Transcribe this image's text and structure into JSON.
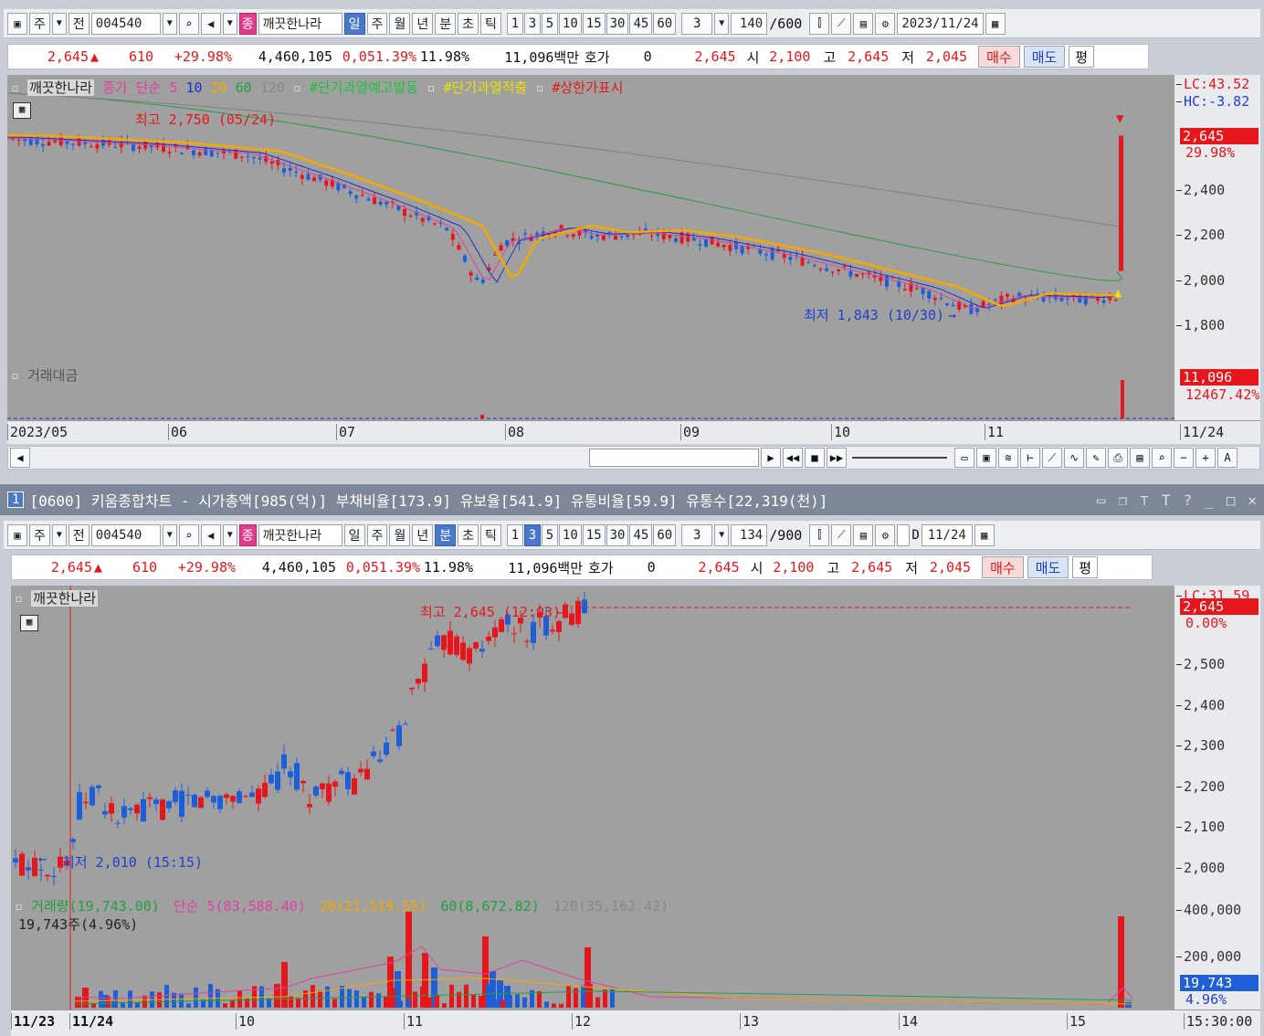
{
  "top": {
    "toolbar": {
      "period": "주",
      "prev": "전",
      "code": "004540",
      "tag": "종",
      "name": "깨끗한나라",
      "tabs": [
        "일",
        "주",
        "월",
        "년",
        "분",
        "초",
        "틱"
      ],
      "active_tab": "일",
      "nums": [
        "1",
        "3",
        "5",
        "10",
        "15",
        "30",
        "45",
        "60"
      ],
      "unit": "3",
      "count": "140",
      "count_max": "/600",
      "date": "2023/11/24"
    },
    "quote": {
      "price": "2,645",
      "change": "610",
      "pct": "+29.98%",
      "volume": "4,460,105",
      "vol2": "0,051.39%",
      "turn": "11.98%",
      "amount": "11,096백만",
      "hoga_label": "호가",
      "hoga": "0",
      "cur": "2,645",
      "open_l": "시",
      "open": "2,100",
      "high_l": "고",
      "high": "2,645",
      "low_l": "저",
      "low": "2,045",
      "buy": "매수",
      "sell": "매도",
      "avg": "평"
    },
    "legend": {
      "name": "깨끗한나라",
      "ma_label": "종가 단순 5",
      "ma10": "10",
      "ma20": "20",
      "ma60": "60",
      "ma120": "120",
      "ind1": "#단기과열예고발동",
      "ind2": "#단기과열적출",
      "ind3": "#상한가표시"
    },
    "annot_high": "최고 2,750 (05/24)",
    "annot_low": "최저 1,843 (10/30)",
    "lc": "LC:43.52",
    "hc": "HC:-3.82",
    "price_tag": "2,645",
    "pct_tag": "29.98%",
    "yticks": [
      "2,400",
      "2,200",
      "2,000",
      "1,800"
    ],
    "vol_label": "거래대금",
    "vol_tag": "11,096",
    "vol_tag2": "12467.42%",
    "xlabels": [
      "2023/05",
      "06",
      "07",
      "08",
      "09",
      "10",
      "11"
    ],
    "x_end": "11/24"
  },
  "window": {
    "num": "1",
    "title": "[0600] 키움종합차트 - 시가총액[985(억)] 부채비율[173.9] 유보율[541.9] 유통비율[59.9] 유통수[22,319(천)]"
  },
  "bottom": {
    "toolbar": {
      "period": "주",
      "prev": "전",
      "code": "004540",
      "tag": "종",
      "name": "깨끗한나라",
      "tabs": [
        "일",
        "주",
        "월",
        "년",
        "분",
        "초",
        "틱"
      ],
      "active_tab": "분",
      "nums": [
        "1",
        "3",
        "5",
        "10",
        "15",
        "30",
        "45",
        "60"
      ],
      "active_num": "3",
      "unit": "3",
      "count": "134",
      "count_max": "/900",
      "dchk": "D",
      "date": "11/24"
    },
    "legend_name": "깨끗한나라",
    "annot_high": "최고 2,645 (12:03)",
    "annot_low": "최저 2,010 (15:15)",
    "lc": "LC:31.59",
    "price_tag": "2,645",
    "pct_tag": "0.00%",
    "yticks": [
      "2,500",
      "2,400",
      "2,300",
      "2,200",
      "2,100",
      "2,000"
    ],
    "vol_legend": {
      "main": "거래량(19,743.00)",
      "ma5": "단순 5(83,588.40)",
      "ma20": "20(21,519.55)",
      "ma60": "60(8,672.82)",
      "ma120": "120(35,162.42)"
    },
    "vol_sub": "19,743주(4.96%)",
    "vol_yticks": [
      "400,000",
      "200,000"
    ],
    "vol_tag": "19,743",
    "vol_tag2": "4.96%",
    "xlabels": [
      "11/23",
      "11/24",
      "10",
      "11",
      "12",
      "13",
      "14",
      "15"
    ],
    "x_end": "15:30:00"
  },
  "colors": {
    "up": "#e5171c",
    "down": "#1e5fd8",
    "ma5": "#e040a0",
    "ma10": "#2030c0",
    "ma20": "#f5a800",
    "ma60": "#20a040",
    "ma120": "#808080"
  }
}
